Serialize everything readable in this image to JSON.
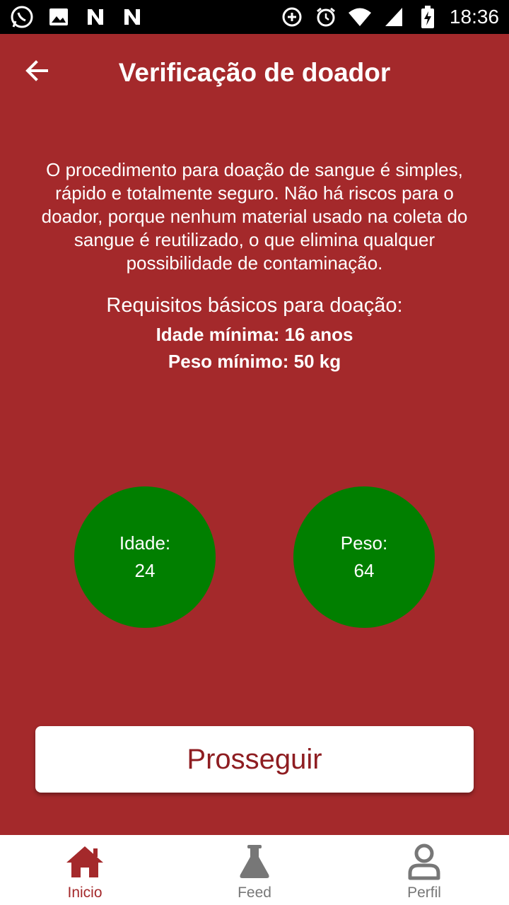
{
  "status_bar": {
    "time": "18:36",
    "left_icons": [
      "whatsapp-icon",
      "image-icon",
      "n-icon",
      "n-icon"
    ],
    "right_icons": [
      "data-saver-icon",
      "alarm-icon",
      "wifi-icon",
      "signal-icon",
      "battery-charging-icon"
    ]
  },
  "header": {
    "back_icon": "arrow-left-icon",
    "title": "Verificação de doador"
  },
  "intro": {
    "text": "O procedimento para doação de sangue é simples, rápido e totalmente seguro. Não há riscos para o doador, porque nenhum material usado na coleta do sangue é reutilizado, o que elimina qualquer possibilidade de contaminação."
  },
  "requirements": {
    "title": "Requisitos básicos para doação:",
    "min_age": "Idade mínima: 16 anos",
    "min_weight": "Peso mínimo: 50 kg"
  },
  "checks": {
    "age_label": "Idade:",
    "age_value": "24",
    "weight_label": "Peso:",
    "weight_value": "64"
  },
  "actions": {
    "proceed_label": "Prosseguir"
  },
  "bottom_nav": {
    "items": [
      {
        "label": "Inicio",
        "icon": "home-icon",
        "active": true
      },
      {
        "label": "Feed",
        "icon": "flask-icon",
        "active": false
      },
      {
        "label": "Perfil",
        "icon": "user-icon",
        "active": false
      }
    ]
  },
  "colors": {
    "background": "#a4292b",
    "circle_ok": "#017f00",
    "accent": "#a4292b",
    "nav_inactive": "#777777"
  }
}
